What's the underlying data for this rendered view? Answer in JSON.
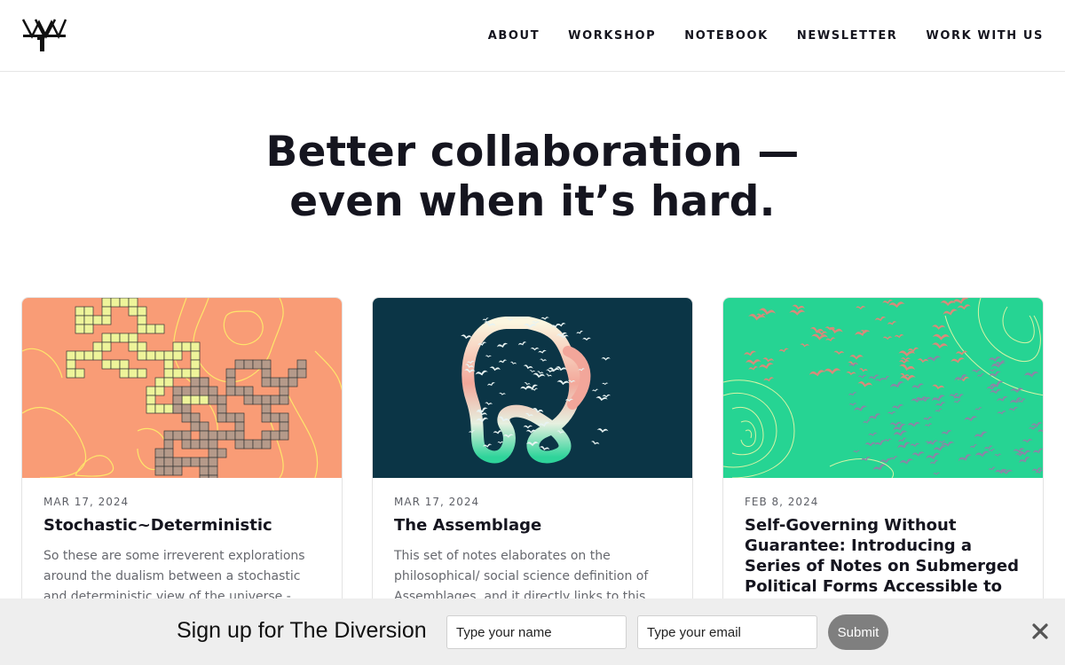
{
  "header": {
    "logo_icon": "workshop-logo-icon",
    "nav": [
      {
        "label": "ABOUT"
      },
      {
        "label": "WORKSHOP"
      },
      {
        "label": "NOTEBOOK"
      },
      {
        "label": "NEWSLETTER"
      },
      {
        "label": "WORK WITH US"
      }
    ]
  },
  "hero": {
    "line1": "Better collaboration —",
    "line2": "even when it’s hard."
  },
  "cards": [
    {
      "date": "MAR 17, 2024",
      "title": "Stochastic~Deterministic",
      "excerpt": "So these are some irreverent explorations around the dualism between a stochastic and deterministic view of the universe -",
      "image_colors": {
        "bg": "#f99c76",
        "accent": "#eef49a"
      }
    },
    {
      "date": "MAR 17, 2024",
      "title": "The Assemblage",
      "excerpt": "This set of notes elaborates on the philosophical/ social science definition of Assemblages, and it directly links to this",
      "image_colors": {
        "bg": "#0b3546",
        "accent": "#2fd49a"
      }
    },
    {
      "date": "FEB 8, 2024",
      "title": "Self-Governing Without Guarantee: Introducing a Series of Notes on Submerged Political Forms Accessible to",
      "excerpt": "",
      "image_colors": {
        "bg": "#26d493",
        "accent": "#9c8a8a"
      }
    }
  ],
  "signup": {
    "title": "Sign up for The Diversion",
    "name_placeholder": "Type your name",
    "email_placeholder": "Type your email",
    "submit_label": "Submit",
    "close_icon": "close-icon"
  }
}
